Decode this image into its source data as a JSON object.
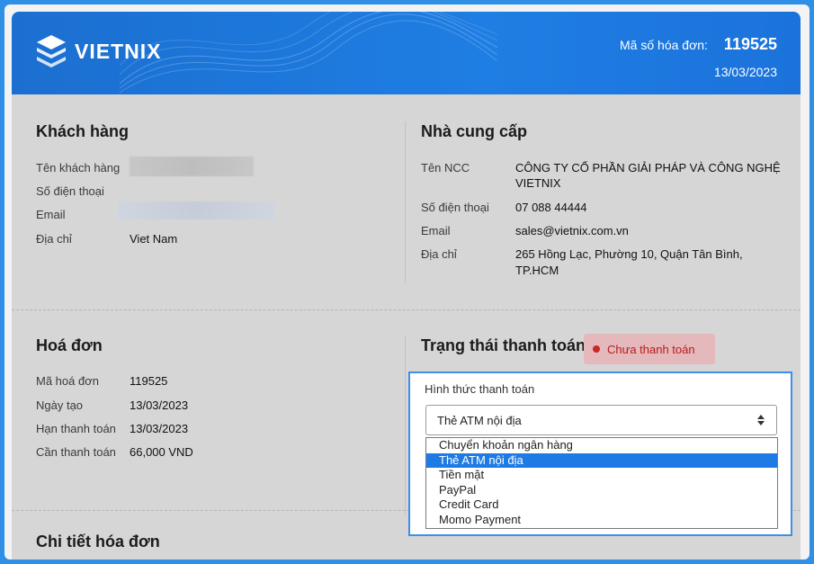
{
  "header": {
    "brand": "VIETNIX",
    "invoice_number_label": "Mã số hóa đơn:",
    "invoice_number": "119525",
    "invoice_date": "13/03/2023"
  },
  "customer": {
    "title": "Khách hàng",
    "name_label": "Tên khách hàng",
    "phone_label": "Số điện thoại",
    "email_label": "Email",
    "address_label": "Địa chỉ",
    "address": "Viet Nam"
  },
  "supplier": {
    "title": "Nhà cung cấp",
    "name_label": "Tên NCC",
    "name_line1": "CÔNG TY CỔ PHẦN GIẢI PHÁP VÀ CÔNG NGHỆ",
    "name_line2": "VIETNIX",
    "phone_label": "Số điện thoại",
    "phone": "07 088 44444",
    "email_label": "Email",
    "email": "sales@vietnix.com.vn",
    "address_label": "Địa chỉ",
    "address_line1": "265 Hồng Lạc, Phường 10, Quận Tân Bình,",
    "address_line2": "TP.HCM"
  },
  "invoice": {
    "title": "Hoá đơn",
    "code_label": "Mã hoá đơn",
    "code": "119525",
    "created_label": "Ngày tạo",
    "created": "13/03/2023",
    "due_label": "Hạn thanh toán",
    "due": "13/03/2023",
    "amount_label": "Cần thanh toán",
    "amount": "66,000 VND"
  },
  "payment": {
    "title": "Trạng thái thanh toán",
    "status": "Chưa thanh toán",
    "method_label": "Hình thức thanh toán",
    "selected": "Thẻ ATM nội địa",
    "options": [
      "Chuyển khoản ngân hàng",
      "Thẻ ATM nội địa",
      "Tiền mặt",
      "PayPal",
      "Credit Card",
      "Momo Payment"
    ],
    "highlighted_index": 1
  },
  "details": {
    "title": "Chi tiết hóa đơn"
  },
  "colors": {
    "brand_blue": "#1f7ee3",
    "status_bg": "#e5b8bb",
    "status_dot": "#c62828",
    "amount": "#e07b2d",
    "link": "#1e6fd1"
  }
}
